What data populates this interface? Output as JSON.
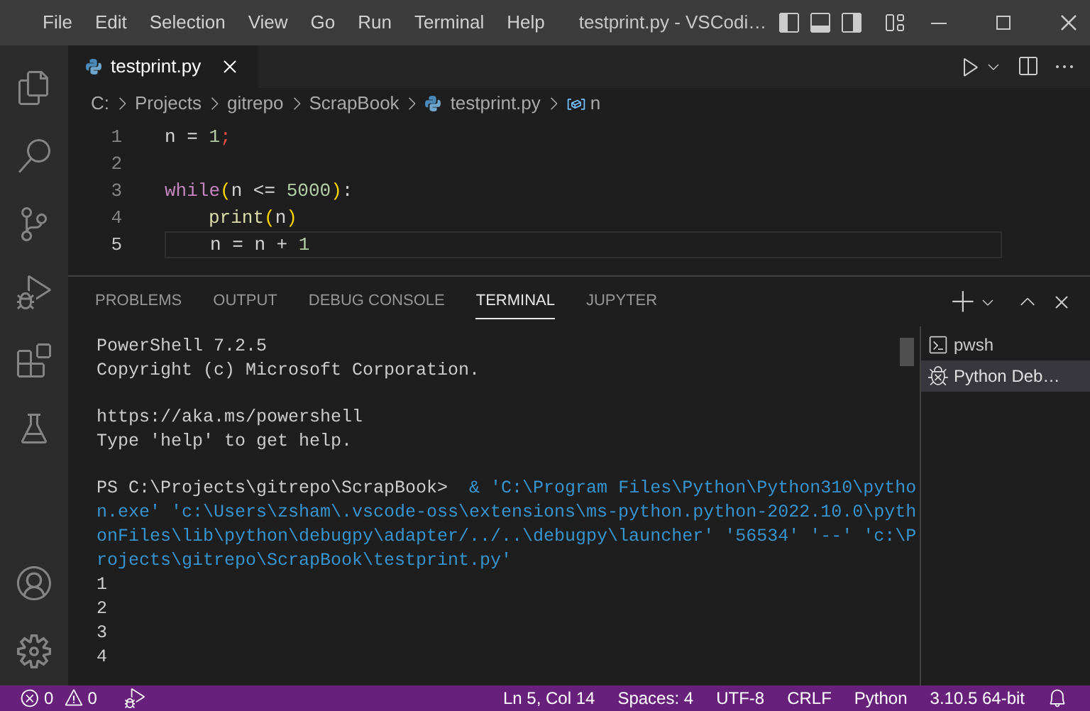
{
  "window": {
    "title": "testprint.py - VSCodi…"
  },
  "menu": [
    "File",
    "Edit",
    "Selection",
    "View",
    "Go",
    "Run",
    "Terminal",
    "Help"
  ],
  "editor_tabs": [
    {
      "label": "testprint.py",
      "selected": true
    }
  ],
  "breadcrumb": [
    "C:",
    "Projects",
    "gitrepo",
    "ScrapBook",
    "testprint.py",
    "n"
  ],
  "code": [
    {
      "number": "1",
      "current": false,
      "indented": false,
      "tokens": [
        {
          "kind": "text",
          "text": "n = "
        },
        {
          "kind": "number",
          "text": "1"
        },
        {
          "kind": "error",
          "text": ";"
        }
      ]
    },
    {
      "number": "2",
      "current": false
    },
    {
      "number": "3",
      "current": false,
      "indented": false,
      "tokens": [
        {
          "kind": "keyword",
          "text": "while"
        },
        {
          "kind": "paren",
          "text": "("
        },
        {
          "kind": "text",
          "text": "n <= "
        },
        {
          "kind": "number",
          "text": "5000"
        },
        {
          "kind": "paren",
          "text": ")"
        },
        {
          "kind": "text",
          "text": ":"
        }
      ]
    },
    {
      "number": "4",
      "current": false,
      "indented": true,
      "tokens": [
        {
          "kind": "function",
          "text": "print"
        },
        {
          "kind": "paren",
          "text": "("
        },
        {
          "kind": "text",
          "text": "n"
        },
        {
          "kind": "paren",
          "text": ")"
        }
      ]
    },
    {
      "number": "5",
      "current": true,
      "indented": true,
      "tokens": [
        {
          "kind": "text",
          "text": "n = n + "
        },
        {
          "kind": "number",
          "text": "1"
        }
      ]
    }
  ],
  "panel_tabs": [
    {
      "label": "PROBLEMS",
      "selected": false
    },
    {
      "label": "OUTPUT",
      "selected": false
    },
    {
      "label": "DEBUG CONSOLE",
      "selected": false
    },
    {
      "label": "TERMINAL",
      "selected": true
    },
    {
      "label": "JUPYTER",
      "selected": false
    }
  ],
  "terminal": {
    "blocks": [
      [
        {
          "kind": "output",
          "text": "PowerShell 7.2.5"
        },
        {
          "kind": "output",
          "text": "Copyright (c) Microsoft Corporation."
        }
      ],
      [
        {
          "kind": "output",
          "text": "https://aka.ms/powershell"
        },
        {
          "kind": "output",
          "text": "Type 'help' to get help."
        }
      ],
      [
        {
          "kind": "prompt",
          "prompt": "PS C:\\Projects\\gitrepo\\ScrapBook>",
          "text": "& 'C:\\Program Files\\Python\\Python310\\pytho"
        },
        {
          "kind": "command",
          "text": "n.exe' 'c:\\Users\\zsham\\.vscode-oss\\extensions\\ms-python.python-2022.10.0\\pyth"
        },
        {
          "kind": "command",
          "text": "onFiles\\lib\\python\\debugpy\\adapter/../..\\debugpy\\launcher' '56534' '--' 'c:\\P"
        },
        {
          "kind": "command",
          "text": "rojects\\gitrepo\\ScrapBook\\testprint.py'"
        },
        {
          "kind": "output",
          "text": "1"
        },
        {
          "kind": "output",
          "text": "2"
        },
        {
          "kind": "output",
          "text": "3"
        },
        {
          "kind": "output",
          "text": "4"
        }
      ]
    ]
  },
  "terminal_list": [
    {
      "kind": "shell",
      "label": "pwsh",
      "selected": false
    },
    {
      "kind": "debug",
      "label": "Python Deb…",
      "selected": true
    }
  ],
  "status_bar": {
    "errors": "0",
    "warnings": "0",
    "right": [
      "Ln 5, Col 14",
      "Spaces: 4",
      "UTF-8",
      "CRLF",
      "Python",
      "3.10.5 64-bit"
    ]
  }
}
